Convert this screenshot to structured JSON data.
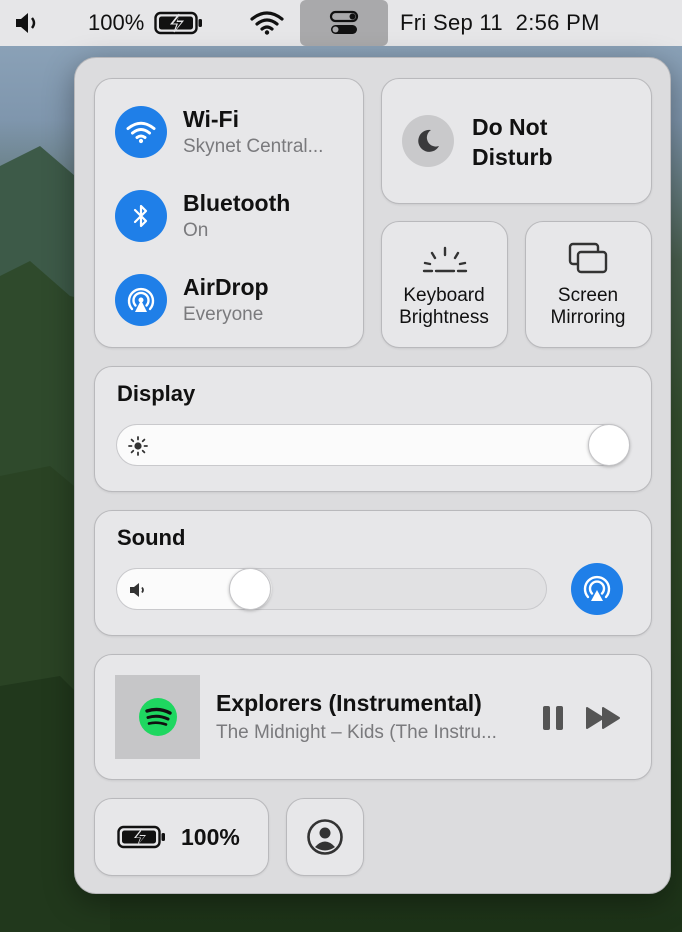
{
  "menubar": {
    "volume_icon": "speaker-icon",
    "battery_percent": "100%",
    "battery_icon": "battery-charging-icon",
    "wifi_icon": "wifi-icon",
    "control_center_icon": "control-center-icon",
    "datetime": "Fri Sep 11  2:56 PM"
  },
  "network": {
    "wifi": {
      "title": "Wi-Fi",
      "subtitle": "Skynet Central...",
      "on": true
    },
    "bluetooth": {
      "title": "Bluetooth",
      "subtitle": "On",
      "on": true
    },
    "airdrop": {
      "title": "AirDrop",
      "subtitle": "Everyone",
      "on": true
    }
  },
  "dnd": {
    "line1": "Do Not",
    "line2": "Disturb",
    "on": false
  },
  "keyboard_brightness": {
    "line1": "Keyboard",
    "line2": "Brightness"
  },
  "screen_mirroring": {
    "line1": "Screen",
    "line2": "Mirroring"
  },
  "display": {
    "title": "Display",
    "brightness": 1.0
  },
  "sound": {
    "title": "Sound",
    "volume": 0.29
  },
  "now_playing": {
    "title": "Explorers (Instrumental)",
    "subtitle": "The Midnight – Kids (The Instru...",
    "app_icon": "spotify-icon",
    "state": "playing"
  },
  "battery": {
    "label": "100%"
  },
  "colors": {
    "accent": "#1f7fe8",
    "spotify": "#1ed760"
  }
}
